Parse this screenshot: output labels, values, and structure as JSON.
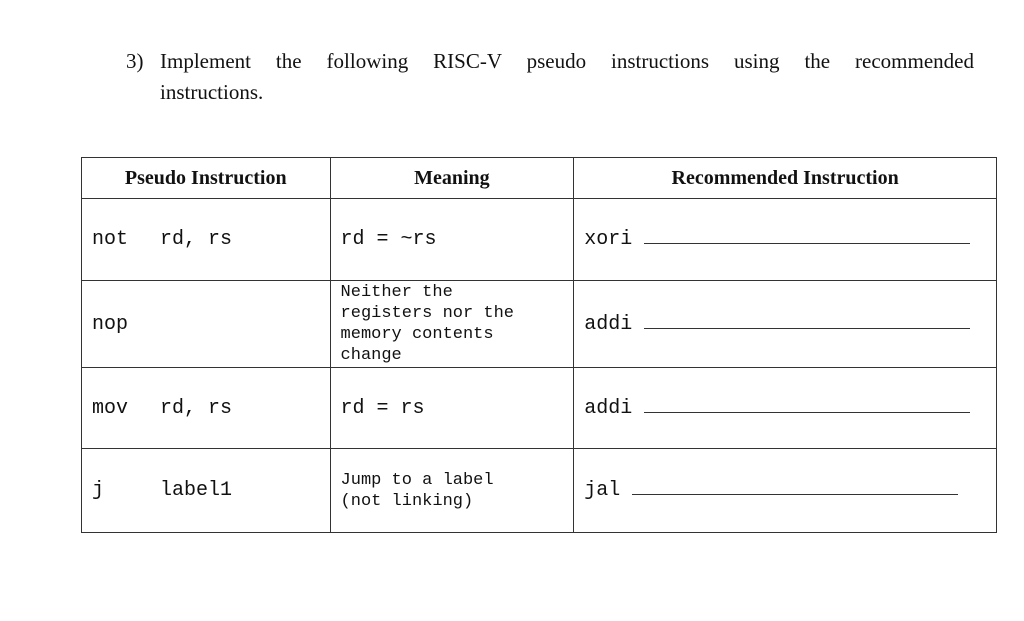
{
  "question": {
    "number": "3)",
    "line1": "Implement the following RISC-V pseudo instructions using the recommended",
    "line2": "instructions."
  },
  "table": {
    "headers": [
      "Pseudo Instruction",
      "Meaning",
      "Recommended Instruction"
    ],
    "rows": [
      {
        "op": "not",
        "args": "rd, rs",
        "meaning": "rd = ~rs",
        "meaning_style": "normal",
        "recommended": "xori",
        "answer": ""
      },
      {
        "op": "nop",
        "args": "",
        "meaning": "Neither the registers nor the memory contents change",
        "meaning_style": "small",
        "recommended": "addi",
        "answer": ""
      },
      {
        "op": "mov",
        "args": "rd, rs",
        "meaning": "rd = rs",
        "meaning_style": "normal",
        "recommended": "addi",
        "answer": ""
      },
      {
        "op": "j",
        "args": "label1",
        "meaning": "Jump to a label (not linking)",
        "meaning_style": "small",
        "recommended": "jal",
        "answer": ""
      }
    ]
  }
}
